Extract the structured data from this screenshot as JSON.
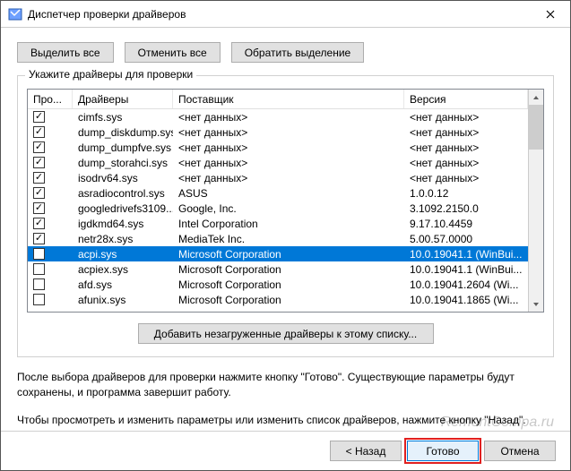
{
  "window": {
    "title": "Диспетчер проверки драйверов"
  },
  "toolbar": {
    "select_all": "Выделить все",
    "deselect_all": "Отменить все",
    "invert": "Обратить выделение"
  },
  "group": {
    "label": "Укажите драйверы для проверки",
    "columns": {
      "c0": "Про...",
      "c1": "Драйверы",
      "c2": "Поставщик",
      "c3": "Версия"
    },
    "rows": [
      {
        "checked": true,
        "driver": "cimfs.sys",
        "vendor": "<нет данных>",
        "version": "<нет данных>"
      },
      {
        "checked": true,
        "driver": "dump_diskdump.sys",
        "vendor": "<нет данных>",
        "version": "<нет данных>"
      },
      {
        "checked": true,
        "driver": "dump_dumpfve.sys",
        "vendor": "<нет данных>",
        "version": "<нет данных>"
      },
      {
        "checked": true,
        "driver": "dump_storahci.sys",
        "vendor": "<нет данных>",
        "version": "<нет данных>"
      },
      {
        "checked": true,
        "driver": "isodrv64.sys",
        "vendor": "<нет данных>",
        "version": "<нет данных>"
      },
      {
        "checked": true,
        "driver": "asradiocontrol.sys",
        "vendor": "ASUS",
        "version": "1.0.0.12"
      },
      {
        "checked": true,
        "driver": "googledrivefs3109...",
        "vendor": "Google, Inc.",
        "version": "3.1092.2150.0"
      },
      {
        "checked": true,
        "driver": "igdkmd64.sys",
        "vendor": "Intel Corporation",
        "version": "9.17.10.4459"
      },
      {
        "checked": true,
        "driver": "netr28x.sys",
        "vendor": "MediaTek Inc.",
        "version": "5.00.57.0000"
      },
      {
        "checked": false,
        "driver": "acpi.sys",
        "vendor": "Microsoft Corporation",
        "version": "10.0.19041.1 (WinBui...",
        "selected": true
      },
      {
        "checked": false,
        "driver": "acpiex.sys",
        "vendor": "Microsoft Corporation",
        "version": "10.0.19041.1 (WinBui..."
      },
      {
        "checked": false,
        "driver": "afd.sys",
        "vendor": "Microsoft Corporation",
        "version": "10.0.19041.2604 (Wi..."
      },
      {
        "checked": false,
        "driver": "afunix.sys",
        "vendor": "Microsoft Corporation",
        "version": "10.0.19041.1865 (Wi..."
      }
    ],
    "add_button": "Добавить незагруженные драйверы к этому списку..."
  },
  "info1": "После выбора драйверов для проверки нажмите кнопку \"Готово\". Существующие параметры будут сохранены, и программа завершит работу.",
  "info2": "Чтобы просмотреть и изменить параметры или изменить список драйверов, нажмите кнопку \"Назад\".",
  "footer": {
    "back": "< Назад",
    "finish": "Готово",
    "cancel": "Отмена"
  },
  "watermark": "RemontCompa.ru"
}
